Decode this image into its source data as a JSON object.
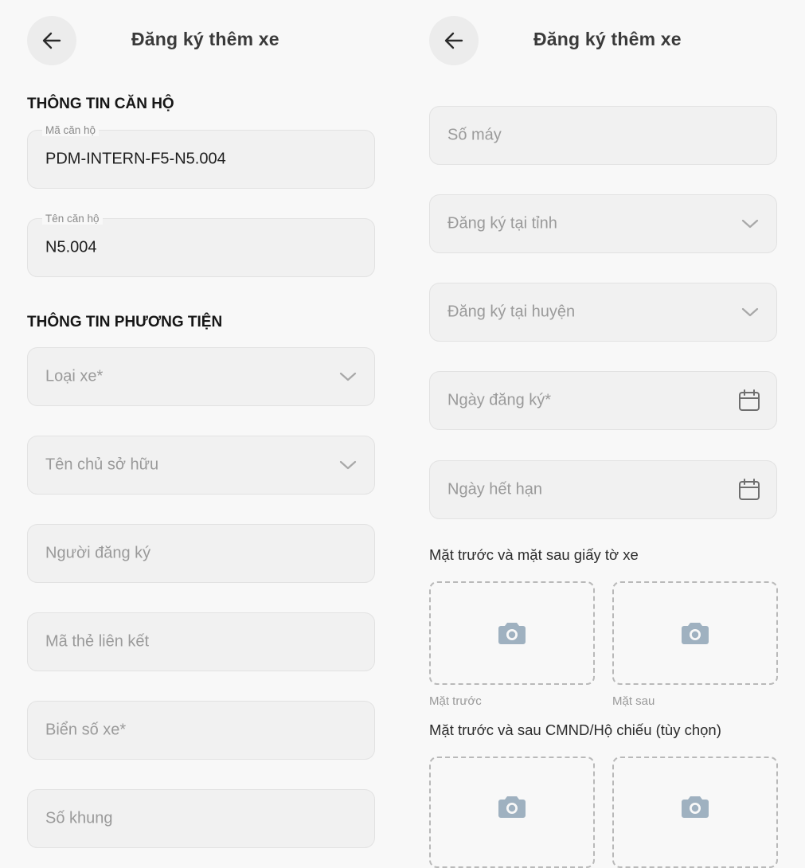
{
  "left": {
    "title": "Đăng ký thêm xe",
    "section_apartment": "THÔNG TIN CĂN HỘ",
    "apartment_code": {
      "label": "Mã căn hộ",
      "value": "PDM-INTERN-F5-N5.004"
    },
    "apartment_name": {
      "label": "Tên căn hộ",
      "value": "N5.004"
    },
    "section_vehicle": "THÔNG TIN PHƯƠNG TIỆN",
    "vehicle_type": "Loại xe*",
    "owner_name": "Tên chủ sở hữu",
    "registrant": "Người đăng ký",
    "link_card": "Mã thẻ liên kết",
    "plate": "Biển số xe*",
    "frame_no": "Số khung"
  },
  "right": {
    "title": "Đăng ký thêm xe",
    "engine_no": "Số máy",
    "province": "Đăng ký tại tỉnh",
    "district": "Đăng ký tại huyện",
    "reg_date": "Ngày đăng ký*",
    "exp_date": "Ngày hết hạn",
    "vehicle_docs_title": "Mặt trước và mặt sau giấy tờ xe",
    "front_label": "Mặt trước",
    "back_label": "Mặt sau",
    "id_docs_title": "Mặt trước và sau CMND/Hộ chiếu (tùy chọn)"
  },
  "icons": {
    "back": "arrow-left-icon",
    "dropdown": "chevron-down-icon",
    "calendar": "calendar-icon",
    "camera": "camera-icon"
  },
  "colors": {
    "background": "#f8f8f8",
    "field_bg": "#f1f1f1",
    "placeholder": "#9a9a9a",
    "camera": "#9fb1c0"
  }
}
